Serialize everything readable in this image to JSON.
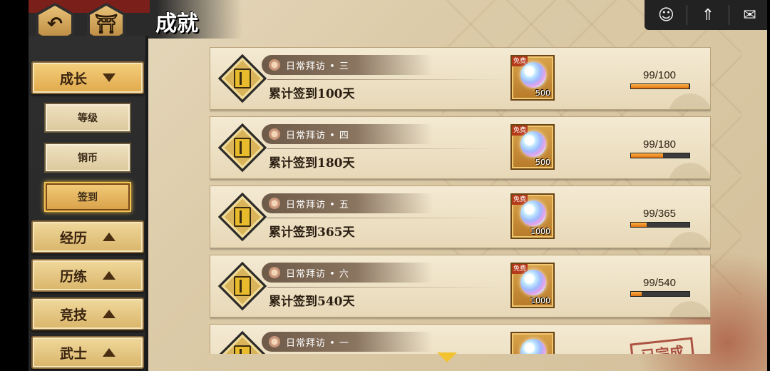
{
  "header": {
    "title": "成就",
    "back_icon": "back-arrow-icon",
    "home_icon": "castle-icon"
  },
  "top_right": {
    "icons": [
      "character-icon",
      "upload-icon",
      "mail-icon"
    ]
  },
  "sidebar": {
    "categories": [
      {
        "label": "成长",
        "state": "expanded"
      },
      {
        "label": "经历",
        "state": "collapsed"
      },
      {
        "label": "历练",
        "state": "collapsed"
      },
      {
        "label": "竞技",
        "state": "collapsed"
      },
      {
        "label": "武士",
        "state": "collapsed"
      }
    ],
    "sub_items": [
      {
        "label": "等级",
        "selected": false
      },
      {
        "label": "铜币",
        "selected": false
      },
      {
        "label": "签到",
        "selected": true
      }
    ]
  },
  "achievements": [
    {
      "tag": "日常拜访 • 三",
      "desc": "累计签到100天",
      "reward_badge": "免费",
      "reward_qty": "500",
      "progress": "99/100",
      "fraction": 0.99
    },
    {
      "tag": "日常拜访 • 四",
      "desc": "累计签到180天",
      "reward_badge": "免费",
      "reward_qty": "500",
      "progress": "99/180",
      "fraction": 0.55
    },
    {
      "tag": "日常拜访 • 五",
      "desc": "累计签到365天",
      "reward_badge": "免费",
      "reward_qty": "1000",
      "progress": "99/365",
      "fraction": 0.27
    },
    {
      "tag": "日常拜访 • 六",
      "desc": "累计签到540天",
      "reward_badge": "免费",
      "reward_qty": "1000",
      "progress": "99/540",
      "fraction": 0.18
    },
    {
      "tag": "日常拜访 • 一",
      "desc": "",
      "reward_badge": "",
      "reward_qty": "",
      "progress": "",
      "fraction": 0,
      "stamp": "已完成"
    }
  ],
  "colors": {
    "accent_gold": "#e0a94b",
    "progress_orange": "#e07010",
    "sidebar_dark": "#2a2a2a"
  }
}
